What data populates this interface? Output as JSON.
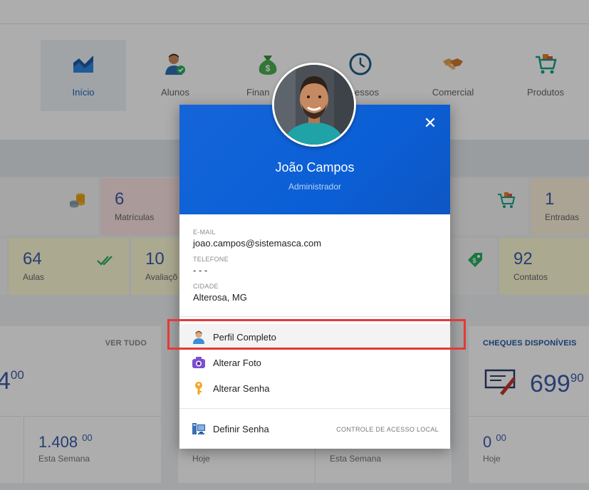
{
  "nav": {
    "items": [
      {
        "label": "Início",
        "icon": "area-chart-icon"
      },
      {
        "label": "Alunos",
        "icon": "student-icon"
      },
      {
        "label": "Finan",
        "icon": "money-bag-icon"
      },
      {
        "label": "essos",
        "icon": "clock-icon"
      },
      {
        "label": "Comercial",
        "icon": "handshake-icon"
      },
      {
        "label": "Produtos",
        "icon": "cart-icon"
      }
    ]
  },
  "stats": {
    "row1": [
      {
        "value": "6",
        "label": "Matrículas"
      },
      {
        "value": "1",
        "label": "Entradas"
      }
    ],
    "row2": [
      {
        "value": "64",
        "label": "Aulas"
      },
      {
        "value": "10",
        "label": "Avaliaçõ"
      },
      {
        "value": "92",
        "label": "Contatos"
      }
    ]
  },
  "cards": {
    "left": {
      "title": "VER TUDO",
      "big_int": "4",
      "big_dec": "00",
      "week_int": "1.408",
      "week_dec": "00",
      "week_label": "Esta Semana"
    },
    "middle": {
      "today_label": "Hoje",
      "week_label": "Esta Semana"
    },
    "right": {
      "title": "CHEQUES DISPONÍVEIS",
      "big_int": "699",
      "big_dec": "90",
      "today_int": "0",
      "today_dec": "00",
      "today_label": "Hoje"
    }
  },
  "profile": {
    "name": "João Campos",
    "role": "Administrador",
    "email_label": "E-MAIL",
    "email": "joao.campos@sistemasca.com",
    "phone_label": "TELEFONE",
    "phone": "- - -",
    "city_label": "CIDADE",
    "city": "Alterosa, MG",
    "close_icon": "close-icon"
  },
  "menu": {
    "full_profile": "Perfil Completo",
    "change_photo": "Alterar Foto",
    "change_password": "Alterar Senha",
    "set_password": "Definir Senha",
    "local_access": "CONTROLE DE ACESSO LOCAL"
  },
  "colors": {
    "header_blue": "#0b5fd6",
    "accent_blue": "#3d5aa8",
    "highlight_red": "#e53935"
  }
}
